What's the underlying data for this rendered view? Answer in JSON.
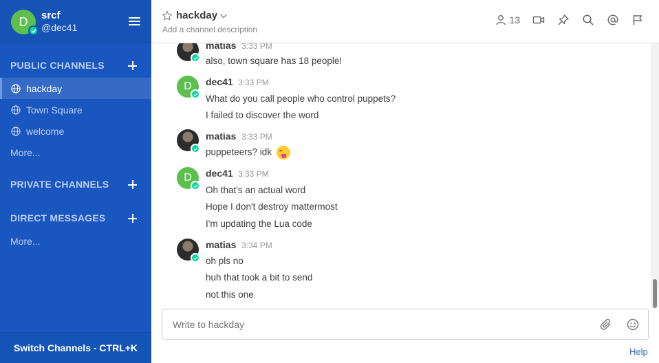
{
  "team": {
    "name": "srcf",
    "username": "@dec41",
    "avatar_letter": "D"
  },
  "sidebar": {
    "public_title": "PUBLIC CHANNELS",
    "public_channels": [
      {
        "label": "hackday",
        "active": true
      },
      {
        "label": "Town Square",
        "active": false
      },
      {
        "label": "welcome",
        "active": false
      }
    ],
    "public_more": "More...",
    "private_title": "PRIVATE CHANNELS",
    "dm_title": "DIRECT MESSAGES",
    "dm_more": "More...",
    "switch_label": "Switch Channels - CTRL+K"
  },
  "header": {
    "channel_name": "hackday",
    "description": "Add a channel description",
    "member_count": "13"
  },
  "messages": [
    {
      "author": "matias",
      "time": "3:33 PM",
      "avatar": "photo",
      "lines": [
        "also, town square has 18 people!"
      ]
    },
    {
      "author": "dec41",
      "time": "3:33 PM",
      "avatar": "D",
      "lines": [
        "What do you call people who control puppets?",
        "I failed to discover the word"
      ]
    },
    {
      "author": "matias",
      "time": "3:33 PM",
      "avatar": "photo",
      "lines": [
        "puppeteers? idk"
      ]
    },
    {
      "author": "dec41",
      "time": "3:33 PM",
      "avatar": "D",
      "lines": [
        "Oh that's an actual word",
        "Hope I don't destroy mattermost",
        "I'm updating the Lua code"
      ]
    },
    {
      "author": "matias",
      "time": "3:34 PM",
      "avatar": "photo",
      "lines": [
        "oh pls no",
        "huh that took a bit to send",
        "not this one"
      ]
    }
  ],
  "post": {
    "placeholder": "Write to hackday"
  },
  "help_label": "Help",
  "colors": {
    "sidebar": "#1a56c0",
    "online": "#06d6a0",
    "avatar_green": "#5dc04e",
    "link": "#2f6fb5"
  }
}
